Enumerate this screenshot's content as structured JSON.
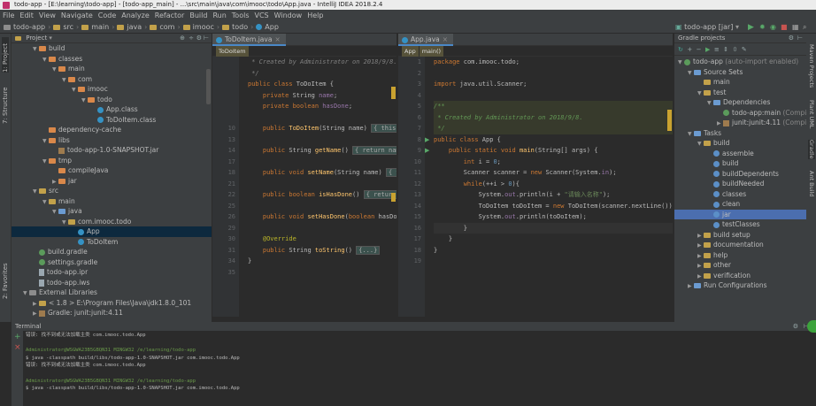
{
  "window": {
    "title": "todo-app - [E:\\learning\\todo-app] - [todo-app_main] - ...\\src\\main\\java\\com\\imooc\\todo\\App.java - IntelliJ IDEA 2018.2.4"
  },
  "menu": [
    "File",
    "Edit",
    "View",
    "Navigate",
    "Code",
    "Analyze",
    "Refactor",
    "Build",
    "Run",
    "Tools",
    "VCS",
    "Window",
    "Help"
  ],
  "breadcrumbs": [
    "todo-app",
    "src",
    "main",
    "java",
    "com",
    "imooc",
    "todo",
    "App"
  ],
  "run_config": "todo-app [jar]",
  "left_strip": {
    "project": "1: Project",
    "structure": "7: Structure",
    "favorites": "2: Favorites"
  },
  "right_strip": [
    "Maven Projects",
    "Plant UML",
    "Gradle",
    "Ant Build"
  ],
  "project_panel": {
    "title": "Project",
    "tree": [
      {
        "depth": 2,
        "arrow": "▼",
        "icon": "folder-orange",
        "label": "build"
      },
      {
        "depth": 3,
        "arrow": "▼",
        "icon": "folder-orange",
        "label": "classes"
      },
      {
        "depth": 4,
        "arrow": "▼",
        "icon": "folder-orange",
        "label": "main"
      },
      {
        "depth": 5,
        "arrow": "▼",
        "icon": "folder-orange",
        "label": "com"
      },
      {
        "depth": 6,
        "arrow": "▼",
        "icon": "folder-orange",
        "label": "imooc"
      },
      {
        "depth": 7,
        "arrow": "▼",
        "icon": "folder-orange",
        "label": "todo"
      },
      {
        "depth": 8,
        "arrow": "",
        "icon": "class",
        "label": "App.class"
      },
      {
        "depth": 8,
        "arrow": "",
        "icon": "class",
        "label": "ToDoItem.class"
      },
      {
        "depth": 3,
        "arrow": "",
        "icon": "folder-orange",
        "label": "dependency-cache"
      },
      {
        "depth": 3,
        "arrow": "▼",
        "icon": "folder-orange",
        "label": "libs"
      },
      {
        "depth": 4,
        "arrow": "",
        "icon": "jar",
        "label": "todo-app-1.0-SNAPSHOT.jar"
      },
      {
        "depth": 3,
        "arrow": "▼",
        "icon": "folder-orange",
        "label": "tmp"
      },
      {
        "depth": 4,
        "arrow": "",
        "icon": "folder-orange",
        "label": "compileJava"
      },
      {
        "depth": 4,
        "arrow": "▶",
        "icon": "folder-orange",
        "label": "jar"
      },
      {
        "depth": 2,
        "arrow": "▼",
        "icon": "folder",
        "label": "src"
      },
      {
        "depth": 3,
        "arrow": "▼",
        "icon": "folder",
        "label": "main"
      },
      {
        "depth": 4,
        "arrow": "▼",
        "icon": "folder-blue",
        "label": "java"
      },
      {
        "depth": 5,
        "arrow": "▼",
        "icon": "folder",
        "label": "com.imooc.todo"
      },
      {
        "depth": 6,
        "arrow": "",
        "icon": "class",
        "label": "App",
        "selected": true
      },
      {
        "depth": 6,
        "arrow": "",
        "icon": "class",
        "label": "ToDoItem"
      },
      {
        "depth": 2,
        "arrow": "",
        "icon": "gradle",
        "label": "build.gradle"
      },
      {
        "depth": 2,
        "arrow": "",
        "icon": "gradle",
        "label": "settings.gradle"
      },
      {
        "depth": 2,
        "arrow": "",
        "icon": "file",
        "label": "todo-app.ipr"
      },
      {
        "depth": 2,
        "arrow": "",
        "icon": "file",
        "label": "todo-app.iws"
      },
      {
        "depth": 1,
        "arrow": "▼",
        "icon": "libs",
        "label": "External Libraries"
      },
      {
        "depth": 2,
        "arrow": "▶",
        "icon": "folder",
        "label": "< 1.8 >  E:\\Program Files\\Java\\jdk1.8.0_101"
      },
      {
        "depth": 2,
        "arrow": "▶",
        "icon": "jar",
        "label": "Gradle: junit:junit:4.11"
      }
    ]
  },
  "editor1": {
    "tab": "ToDoItem.java",
    "header": "ToDoItem",
    "lines": [
      {
        "n": "",
        "html": "<span class='cm'> * Created by Administrator on 2018/9/8.</span>"
      },
      {
        "n": "",
        "html": "<span class='cm'> */</span>"
      },
      {
        "n": "",
        "html": "<span class='kw'>public class</span> ToDoItem {"
      },
      {
        "n": "",
        "html": "    <span class='kw'>private</span> String <span class='fld'>name</span>;"
      },
      {
        "n": "",
        "html": "    <span class='kw'>private boolean</span> <span class='fld'>hasDone</span>;"
      },
      {
        "n": "",
        "html": ""
      },
      {
        "n": "10",
        "html": "    <span class='kw'>public</span> <span class='fn'>ToDoItem</span>(String name) <span class='fold-t'>{ this.name</span>"
      },
      {
        "n": "13",
        "html": ""
      },
      {
        "n": "14",
        "html": "    <span class='kw'>public</span> String <span class='fn'>getName</span>() <span class='fold-t'>{ return name; }</span>"
      },
      {
        "n": "17",
        "html": ""
      },
      {
        "n": "18",
        "html": "    <span class='kw'>public void</span> <span class='fn'>setName</span>(String name) <span class='fold-t'>{ this</span>"
      },
      {
        "n": "21",
        "html": ""
      },
      {
        "n": "22",
        "html": "    <span class='kw'>public boolean</span> <span class='fn'>isHasDone</span>() <span class='fold-t'>{ return has</span>"
      },
      {
        "n": "25",
        "html": ""
      },
      {
        "n": "26",
        "html": "    <span class='kw'>public void</span> <span class='fn'>setHasDone</span>(<span class='kw'>boolean</span> hasDone){"
      },
      {
        "n": "29",
        "html": ""
      },
      {
        "n": "30",
        "html": "    <span class='ann'>@Override</span>"
      },
      {
        "n": "31",
        "html": "    <span class='kw'>public</span> String <span class='fn'>toString</span>() <span class='fold-t'>{...}</span>"
      },
      {
        "n": "34",
        "html": "}"
      },
      {
        "n": "35",
        "html": ""
      }
    ]
  },
  "editor2": {
    "tab": "App.java",
    "header": [
      "App",
      "main()"
    ],
    "lines": [
      {
        "n": "1",
        "html": "<span class='kw'>package</span> com.imooc.todo;"
      },
      {
        "n": "2",
        "html": ""
      },
      {
        "n": "3",
        "html": "<span class='kw'>import</span> java.util.Scanner;"
      },
      {
        "n": "4",
        "html": ""
      },
      {
        "n": "5",
        "html": "<span class='doc'>/**</span>",
        "doc": true
      },
      {
        "n": "6",
        "html": "<span class='doc'> * Created by Administrator on 2018/9/8.</span>",
        "doc": true
      },
      {
        "n": "7",
        "html": "<span class='doc'> */</span>",
        "doc": true
      },
      {
        "n": "8",
        "html": "<span class='kw'>public class</span> App {",
        "run": true
      },
      {
        "n": "9",
        "html": "    <span class='kw'>public static void</span> <span class='fn'>main</span>(String[] args) {",
        "run": true
      },
      {
        "n": "10",
        "html": "        <span class='kw'>int</span> i = <span class='num'>0</span>;"
      },
      {
        "n": "11",
        "html": "        Scanner scanner = <span class='kw'>new</span> Scanner(System.<span class='fld'>in</span>);"
      },
      {
        "n": "12",
        "html": "        <span class='kw'>while</span>(++i > <span class='num'>0</span>){"
      },
      {
        "n": "13",
        "html": "            System.<span class='fld'>out</span>.println(i + <span class='str'>\"请输入名称\"</span>);"
      },
      {
        "n": "14",
        "html": "            ToDoItem toDoItem = <span class='kw'>new</span> ToDoItem(scanner.nextLine());"
      },
      {
        "n": "15",
        "html": "            System.<span class='fld'>out</span>.println(toDoItem);"
      },
      {
        "n": "16",
        "html": "        }",
        "hl": true
      },
      {
        "n": "17",
        "html": "    }"
      },
      {
        "n": "18",
        "html": "}"
      },
      {
        "n": "19",
        "html": ""
      }
    ]
  },
  "gradle_panel": {
    "title": "Gradle projects",
    "tree": [
      {
        "depth": 0,
        "arrow": "▼",
        "icon": "gradle",
        "label": "todo-app",
        "extra": " (auto-import enabled)"
      },
      {
        "depth": 1,
        "arrow": "▼",
        "icon": "folder-blue",
        "label": "Source Sets"
      },
      {
        "depth": 2,
        "arrow": "",
        "icon": "folder",
        "label": "main"
      },
      {
        "depth": 2,
        "arrow": "▼",
        "icon": "folder",
        "label": "test"
      },
      {
        "depth": 3,
        "arrow": "▼",
        "icon": "folder-blue",
        "label": "Dependencies"
      },
      {
        "depth": 4,
        "arrow": "",
        "icon": "gradle",
        "label": "todo-app:main",
        "extra": " (Compile)"
      },
      {
        "depth": 4,
        "arrow": "▶",
        "icon": "jar",
        "label": "junit:junit:4.11",
        "extra": " (Compile)"
      },
      {
        "depth": 1,
        "arrow": "▼",
        "icon": "folder-blue",
        "label": "Tasks"
      },
      {
        "depth": 2,
        "arrow": "▼",
        "icon": "folder",
        "label": "build"
      },
      {
        "depth": 3,
        "arrow": "",
        "icon": "task",
        "label": "assemble"
      },
      {
        "depth": 3,
        "arrow": "",
        "icon": "task",
        "label": "build"
      },
      {
        "depth": 3,
        "arrow": "",
        "icon": "task",
        "label": "buildDependents"
      },
      {
        "depth": 3,
        "arrow": "",
        "icon": "task",
        "label": "buildNeeded"
      },
      {
        "depth": 3,
        "arrow": "",
        "icon": "task",
        "label": "classes"
      },
      {
        "depth": 3,
        "arrow": "",
        "icon": "task",
        "label": "clean"
      },
      {
        "depth": 3,
        "arrow": "",
        "icon": "task",
        "label": "jar",
        "selected": true
      },
      {
        "depth": 3,
        "arrow": "",
        "icon": "task",
        "label": "testClasses"
      },
      {
        "depth": 2,
        "arrow": "▶",
        "icon": "folder",
        "label": "build setup"
      },
      {
        "depth": 2,
        "arrow": "▶",
        "icon": "folder",
        "label": "documentation"
      },
      {
        "depth": 2,
        "arrow": "▶",
        "icon": "folder",
        "label": "help"
      },
      {
        "depth": 2,
        "arrow": "▶",
        "icon": "folder",
        "label": "other"
      },
      {
        "depth": 2,
        "arrow": "▶",
        "icon": "folder",
        "label": "verification"
      },
      {
        "depth": 1,
        "arrow": "▶",
        "icon": "folder-blue",
        "label": "Run Configurations"
      }
    ]
  },
  "terminal": {
    "title": "Terminal",
    "lines": [
      {
        "cls": "",
        "text": "错误: 找不到或无法加载主类 com.imooc.todo.App"
      },
      {
        "cls": "",
        "text": ""
      },
      {
        "cls": "g",
        "text": "Administrator@WSGWA23B5GBQN31 MINGW32 /e/learning/todo-app"
      },
      {
        "cls": "",
        "text": "$ java -classpath build/libs/todo-app-1.0-SNAPSHOT.jar com.imooc.todo.App"
      },
      {
        "cls": "",
        "text": "错误: 找不到或无法加载主类 com.imooc.todo.App"
      },
      {
        "cls": "",
        "text": ""
      },
      {
        "cls": "g",
        "text": "Administrator@WSGWA23B5GBQN31 MINGW32 /e/learning/todo-app"
      },
      {
        "cls": "",
        "text": "$ java -classpath build/libs/todo-app-1.0-SNAPSHOT.jar com.imooc.todo.App"
      }
    ]
  }
}
